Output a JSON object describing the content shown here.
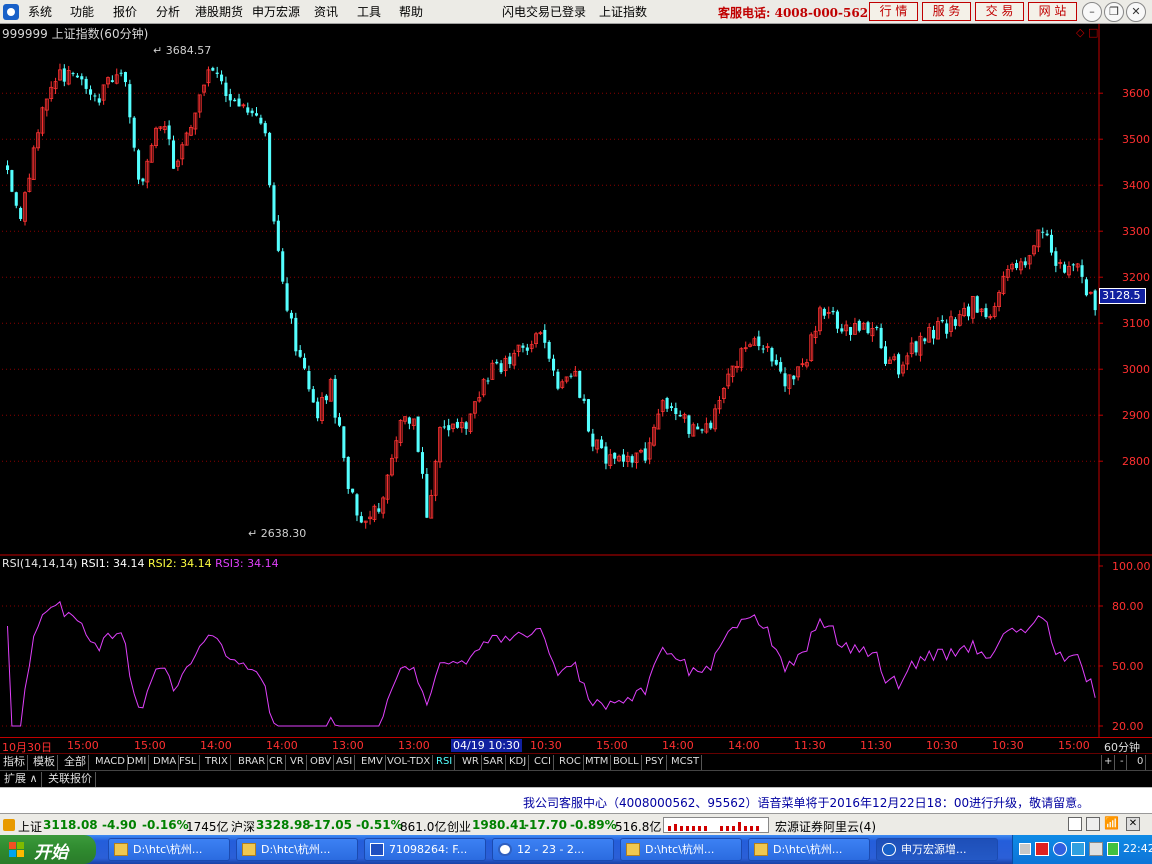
{
  "menu": {
    "items": [
      "系统",
      "功能",
      "报价",
      "分析",
      "港股期货",
      "申万宏源",
      "资讯",
      "工具",
      "帮助"
    ],
    "login_status": "闪电交易已登录",
    "current_index": "上证指数",
    "hotline": "客服电话: 4008-000-562",
    "buttons": [
      "行 情",
      "服 务",
      "交 易",
      "网 站"
    ]
  },
  "chart": {
    "title": "999999 上证指数(60分钟)",
    "high_label": "3684.57",
    "low_label": "2638.30",
    "current_price": "3128.5",
    "price_ticks": [
      "3600",
      "3500",
      "3400",
      "3300",
      "3200",
      "3100",
      "3000",
      "2900",
      "2800"
    ],
    "rsi_legend": {
      "name": "RSI(14,14,14)",
      "rsi1": "RSI1: 34.14",
      "rsi2": "RSI2: 34.14",
      "rsi3": "RSI3: 34.14"
    },
    "rsi_ticks": [
      "100.00",
      "80.00",
      "50.00",
      "20.00"
    ],
    "colors": {
      "up": "#ff3232",
      "down": "#54ffff",
      "rsi": "#e040fb",
      "axis": "#c00000"
    }
  },
  "chart_data": [
    {
      "type": "candlestick",
      "title": "999999 上证指数(60分钟)",
      "ylim": [
        2620,
        3720
      ],
      "y_ticks": [
        2800,
        2900,
        3000,
        3100,
        3200,
        3300,
        3400,
        3500,
        3600
      ],
      "annotations": {
        "high": 3684.57,
        "low": 2638.3,
        "last": 3128.5
      },
      "close_path": [
        [
          0,
          3420
        ],
        [
          3,
          3330
        ],
        [
          8,
          3560
        ],
        [
          12,
          3640
        ],
        [
          16,
          3620
        ],
        [
          20,
          3580
        ],
        [
          26,
          3660
        ],
        [
          30,
          3380
        ],
        [
          34,
          3560
        ],
        [
          38,
          3440
        ],
        [
          42,
          3560
        ],
        [
          46,
          3660
        ],
        [
          50,
          3600
        ],
        [
          54,
          3580
        ],
        [
          58,
          3520
        ],
        [
          62,
          3200
        ],
        [
          66,
          3020
        ],
        [
          70,
          2900
        ],
        [
          73,
          2970
        ],
        [
          77,
          2760
        ],
        [
          80,
          2660
        ],
        [
          84,
          2700
        ],
        [
          88,
          2860
        ],
        [
          92,
          2900
        ],
        [
          95,
          2680
        ],
        [
          98,
          2900
        ],
        [
          102,
          2850
        ],
        [
          106,
          2940
        ],
        [
          110,
          3000
        ],
        [
          114,
          3020
        ],
        [
          118,
          3060
        ],
        [
          122,
          3060
        ],
        [
          125,
          2950
        ],
        [
          128,
          3010
        ],
        [
          132,
          2850
        ],
        [
          136,
          2800
        ],
        [
          140,
          2820
        ],
        [
          144,
          2800
        ],
        [
          148,
          2920
        ],
        [
          152,
          2900
        ],
        [
          156,
          2860
        ],
        [
          160,
          2900
        ],
        [
          164,
          3000
        ],
        [
          168,
          3060
        ],
        [
          172,
          3040
        ],
        [
          176,
          2960
        ],
        [
          180,
          3000
        ],
        [
          184,
          3130
        ],
        [
          188,
          3100
        ],
        [
          192,
          3090
        ],
        [
          196,
          3100
        ],
        [
          198,
          3020
        ],
        [
          202,
          3000
        ],
        [
          206,
          3060
        ],
        [
          210,
          3090
        ],
        [
          214,
          3100
        ],
        [
          218,
          3140
        ],
        [
          222,
          3120
        ],
        [
          226,
          3200
        ],
        [
          230,
          3240
        ],
        [
          234,
          3300
        ],
        [
          238,
          3220
        ],
        [
          242,
          3230
        ],
        [
          246,
          3128.5
        ]
      ]
    },
    {
      "type": "line",
      "title": "RSI(14,14,14)",
      "ylim": [
        15,
        105
      ],
      "y_ticks": [
        20,
        50,
        80,
        100
      ],
      "last": {
        "RSI1": 34.14,
        "RSI2": 34.14,
        "RSI3": 34.14
      }
    }
  ],
  "time_axis": [
    "10月30日",
    "15:00",
    "15:00",
    "14:00",
    "14:00",
    "13:00",
    "13:00",
    "04/19 10:30",
    "10:30",
    "15:00",
    "14:00",
    "14:00",
    "11:30",
    "11:30",
    "10:30",
    "10:30",
    "15:00"
  ],
  "period_label": "60分钟",
  "zoom_controls": [
    "+",
    "-",
    "0"
  ],
  "indicator_tabs": [
    "指标",
    "模板",
    "全部",
    "MACD",
    "DMI",
    "DMA",
    "FSL",
    "TRIX",
    "BRAR",
    "CR",
    "VR",
    "OBV",
    "ASI",
    "EMV",
    "VOL-TDX",
    "RSI",
    "WR",
    "SAR",
    "KDJ",
    "CCI",
    "ROC",
    "MTM",
    "BOLL",
    "PSY",
    "MCST"
  ],
  "active_indicator": "RSI",
  "expand_tabs": [
    "扩展",
    "关联报价"
  ],
  "notice": "我公司客服中心（4008000562、95562）语音菜单将于2016年12月22日18：00进行升级，敬请留意。",
  "status": {
    "sh_label": "上证",
    "sh_value": "3118.08",
    "sh_change": "-4.90",
    "sh_pct": "-0.16%",
    "sh_amount": "1745亿",
    "hs_label": "沪深",
    "hs_value": "3328.98",
    "hs_change": "-17.05",
    "hs_pct": "-0.51%",
    "hs_amount": "861.0亿",
    "cy_label": "创业",
    "cy_value": "1980.41",
    "cy_change": "-17.70",
    "cy_pct": "-0.89%",
    "cy_amount": "516.8亿",
    "broker": "宏源证券阿里云(4)"
  },
  "taskbar": {
    "start": "开始",
    "tasks": [
      "D:\\htc\\杭州...",
      "D:\\htc\\杭州...",
      "71098264: F...",
      "12 - 23 - 2...",
      "D:\\htc\\杭州...",
      "D:\\htc\\杭州...",
      "申万宏源增..."
    ],
    "clock": "22:42"
  }
}
